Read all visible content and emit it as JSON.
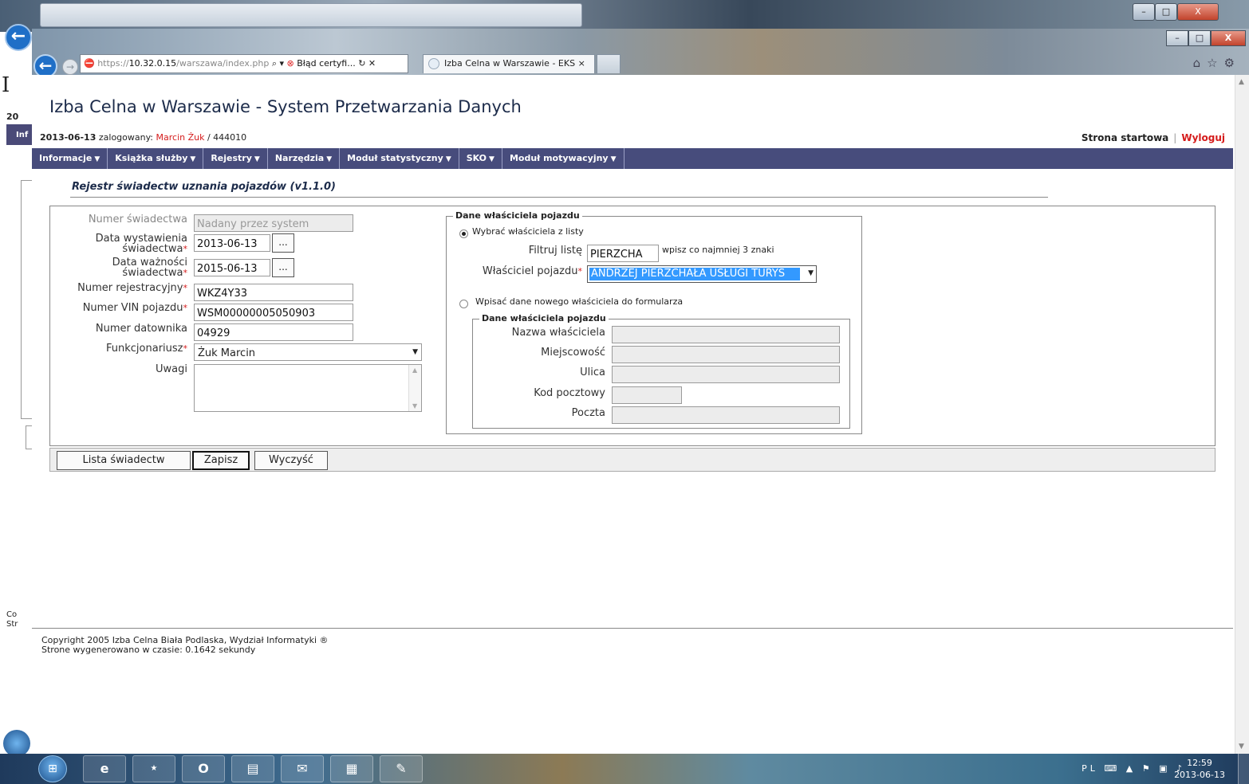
{
  "background_window": {
    "page_initial": "I",
    "year_fragment": "20",
    "nav_fragment": "Inf",
    "footer_fragment": [
      "Co",
      "Str"
    ]
  },
  "browser": {
    "address": {
      "scheme": "https://",
      "host": "10.32.0.15",
      "path": "/warszawa/index.php",
      "cert_error": "Błąd certyfi..."
    },
    "tab_title": "Izba Celna w Warszawie - EKS",
    "window_buttons": [
      "–",
      "□",
      "X"
    ],
    "toolbar_icons": [
      "home-icon",
      "star-icon",
      "gear-icon"
    ]
  },
  "app": {
    "title": "Izba Celna w Warszawie - System Przetwarzania Danych",
    "date": "2013-06-13",
    "logged_label": "zalogowany:",
    "user_name": "Marcin Żuk",
    "user_id": "/ 444010",
    "start_link": "Strona startowa",
    "logout_link": "Wyloguj",
    "nav": [
      {
        "label": "Informacje"
      },
      {
        "label": "Książka służby"
      },
      {
        "label": "Rejestry"
      },
      {
        "label": "Narzędzia"
      },
      {
        "label": "Moduł statystyczny"
      },
      {
        "label": "SKO"
      },
      {
        "label": "Moduł motywacyjny"
      }
    ],
    "page_header": "Rejestr świadectw uznania pojazdów (v1.1.0)"
  },
  "form": {
    "cert_number": {
      "label": "Numer świadectwa",
      "placeholder": "Nadany przez system"
    },
    "issue_date": {
      "label_line1": "Data wystawienia",
      "label_line2": "świadectwa",
      "value": "2013-06-13",
      "button": "..."
    },
    "expiry_date": {
      "label_line1": "Data ważności",
      "label_line2": "świadectwa",
      "value": "2015-06-13",
      "button": "..."
    },
    "registration": {
      "label": "Numer rejestracyjny",
      "value": "WKZ4Y33"
    },
    "vin": {
      "label": "Numer VIN pojazdu",
      "value": "WSM00000005050903"
    },
    "stamp_number": {
      "label": "Numer datownika",
      "value": "04929"
    },
    "officer": {
      "label": "Funkcjonariusz",
      "value": "Żuk Marcin"
    },
    "notes": {
      "label": "Uwagi",
      "value": ""
    },
    "required_mark": "*"
  },
  "owner": {
    "legend": "Dane właściciela pojazdu",
    "option_list": "Wybrać właściciela z listy",
    "filter_label": "Filtruj listę",
    "filter_value": "PIERZCHA",
    "filter_hint": "wpisz co najmniej 3 znaki",
    "owner_label": "Właściciel pojazdu",
    "owner_value": "ANDRZEJ PIERZCHAŁA USŁUGI TURYS",
    "option_new": "Wpisać dane nowego właściciela do formularza",
    "new_legend": "Dane właściciela pojazdu",
    "new_fields": [
      "Nazwa właściciela",
      "Miejscowość",
      "Ulica",
      "Kod pocztowy",
      "Poczta"
    ]
  },
  "buttons": {
    "list": "Lista świadectw",
    "save": "Zapisz",
    "clear": "Wyczyść"
  },
  "footer": {
    "line1": "Copyright 2005 Izba Celna Biała Podlaska, Wydział Informatyki ®",
    "line2": "Strone wygenerowano w czasie: 0.1642 sekundy"
  },
  "taskbar": {
    "language": "PL",
    "time": "12:59",
    "date": "2013-06-13"
  }
}
